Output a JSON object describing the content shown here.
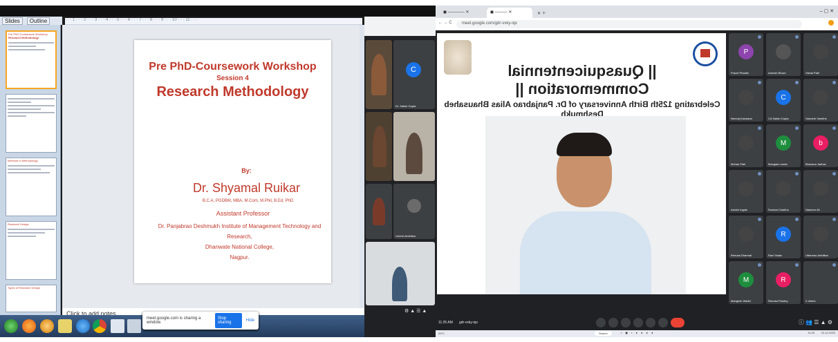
{
  "powerpoint": {
    "tabs": [
      "Slides",
      "Outline"
    ],
    "notes_placeholder": "Click to add notes",
    "slide": {
      "title": "Pre PhD-Coursework Workshop",
      "session": "Session 4",
      "topic": "Research Methodology",
      "by": "By:",
      "speaker": "Dr. Shyamal Ruikar",
      "degrees": "B.C.A, PGDBM, MBA, M.Com, M.Phil, B.Ed, PhD",
      "position": "Assistant Professor",
      "institute_line1": "Dr. Panjabrao Deshmukh Institute of Management Technology and Research,",
      "institute_line2": "Dhanwate National College,",
      "institute_line3": "Nagpur."
    },
    "thumbs": [
      {
        "title": "Pre PhD-Coursework Workshop",
        "sub": "Research Methodology"
      },
      {
        "title": "",
        "sub": ""
      },
      {
        "title": "Methods in Methodology",
        "sub": ""
      },
      {
        "title": "Research Design",
        "sub": ""
      },
      {
        "title": "Types of Research Design",
        "sub": ""
      }
    ]
  },
  "sharing_bar": {
    "message": "meet.google.com is sharing a window.",
    "stop_label": "Stop sharing",
    "hide_label": "Hide"
  },
  "browser": {
    "url": "meet.google.com/gdr-vxky-iqx",
    "tab_label": "Meet – gdr-vxky-iqx"
  },
  "presentation": {
    "heading": "|| Quasquicentennial Commemoration ||",
    "subheading": "Celebrating 125th Birth Anniversary of Dr. Panjabrao Alias Bhausaheb Deshmukh"
  },
  "participants": [
    {
      "name": "Prachi Phadke",
      "initial": "P",
      "color": "#8e44ad"
    },
    {
      "name": "Amresh Bhure",
      "initial": "",
      "color": "#555"
    },
    {
      "name": "Vishal Patil",
      "initial": "",
      "color": "#444"
    },
    {
      "name": "Nemraj Kanaskar",
      "initial": "",
      "color": "#444"
    },
    {
      "name": "CA Satish Gupta",
      "initial": "C",
      "color": "#1a73e8"
    },
    {
      "name": "Samarth Vambhe",
      "initial": "",
      "color": "#444"
    },
    {
      "name": "Mohan Patil",
      "initial": "",
      "color": "#444"
    },
    {
      "name": "Mangala Landa",
      "initial": "M",
      "color": "#1e8e3e"
    },
    {
      "name": "Bhavana Jadhav",
      "initial": "b",
      "color": "#e91e63"
    },
    {
      "name": "Ashish Ingale",
      "initial": "",
      "color": "#444"
    },
    {
      "name": "Roshani Gadkhe",
      "initial": "",
      "color": "#444"
    },
    {
      "name": "Nadeem Ali",
      "initial": "",
      "color": "#444"
    },
    {
      "name": "Renuka Dharmal",
      "initial": "",
      "color": "#444"
    },
    {
      "name": "Ravi Yadav",
      "initial": "R",
      "color": "#1a73e8"
    },
    {
      "name": "Uttamrao Ambilkar",
      "initial": "",
      "color": "#444"
    },
    {
      "name": "Mangesh Wadhi",
      "initial": "M",
      "color": "#1e8e3e"
    },
    {
      "name": "Renuka Pandey",
      "initial": "R",
      "color": "#e91e63"
    },
    {
      "name": "2 others",
      "initial": "",
      "color": "#3c4043"
    }
  ],
  "left_meet": {
    "tile_labels": [
      "Dr. Satish Gupta",
      "Umesh Ambilkar"
    ],
    "initial": "C"
  },
  "meeting_bar": {
    "time": "11:25 AM",
    "code": "gdr-vxky-iqx"
  },
  "taskbar": {
    "weather": "29°C",
    "search": "Search",
    "clock": "11:25",
    "date": "22-12-2023"
  }
}
